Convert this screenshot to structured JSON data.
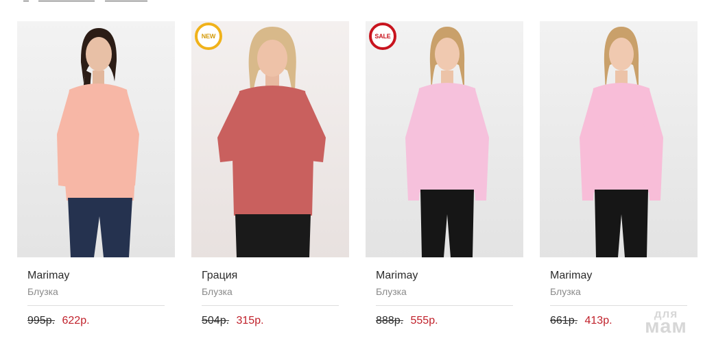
{
  "products": [
    {
      "brand": "Marimay",
      "kind": "Блузка",
      "old_price": "995р.",
      "price": "622р.",
      "badge": "",
      "photo": {
        "blouse_color": "#f7b7a6",
        "trousers_color": "#25324f",
        "hair_color": "#2c1d16"
      }
    },
    {
      "brand": "Грация",
      "kind": "Блузка",
      "old_price": "504р.",
      "price": "315р.",
      "badge": "NEW",
      "photo": {
        "blouse_color": "#c9605e",
        "trousers_color": "#1a1a1a",
        "hair_color": "#d8b98a"
      }
    },
    {
      "brand": "Marimay",
      "kind": "Блузка",
      "old_price": "888р.",
      "price": "555р.",
      "badge": "SALE",
      "photo": {
        "blouse_color": "#f6c1dc",
        "trousers_color": "#161616",
        "hair_color": "#c9a06a"
      }
    },
    {
      "brand": "Marimay",
      "kind": "Блузка",
      "old_price": "661р.",
      "price": "413р.",
      "badge": "",
      "photo": {
        "blouse_color": "#f8bdd8",
        "trousers_color": "#161616",
        "hair_color": "#c9a06a"
      }
    }
  ],
  "colors": {
    "old_price": "#2b2b2b",
    "sale_price": "#c0202a",
    "new_badge": "#f0b21a",
    "sale_badge": "#c8141e"
  },
  "watermark": {
    "line1": "для",
    "line2": "мам"
  }
}
